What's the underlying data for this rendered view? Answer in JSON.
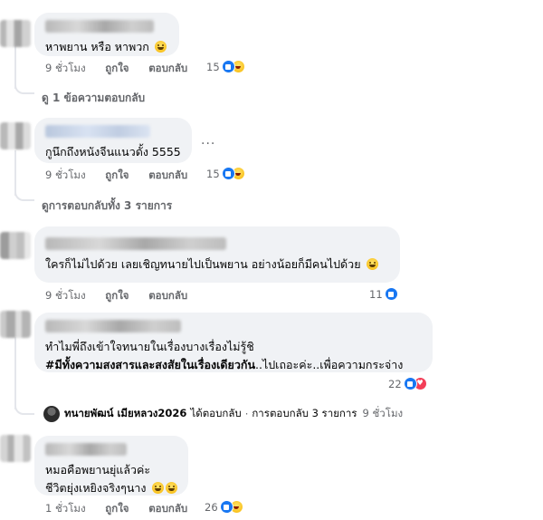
{
  "comments": [
    {
      "text": "หาพยาน หรือ หาพวก",
      "time": "9 ชั่วโมง",
      "like": "ถูกใจ",
      "reply": "ตอบกลับ",
      "count": "15",
      "reactions": [
        "like",
        "haha"
      ]
    },
    {
      "text": "กูนึกถึงหนังจีนแนวดั้ง 5555",
      "time": "9 ชั่วโมง",
      "like": "ถูกใจ",
      "reply": "ตอบกลับ",
      "count": "15",
      "reactions": [
        "like",
        "haha"
      ]
    },
    {
      "text": "ใครก็ไม่ไปด้วย เลยเชิญทนายไปเป็นพยาน อย่างน้อยก็มีคนไปด้วย",
      "time": "9 ชั่วโมง",
      "like": "ถูกใจ",
      "reply": "ตอบกลับ",
      "count": "11",
      "reactions": [
        "like"
      ]
    },
    {
      "text_line1": "ทำไมพี่ถึงเข้าใจทนายในเรื่องบางเรื่องไม่รู้ชิ",
      "hashtag": "#มีทั้งความสงสารและสงสัยในเรื่องเดียวกัน",
      "text_line2_rest": "..ไปเถอะค่ะ..เพื่อความกระจ่าง",
      "time": "9 ชั่วโมง",
      "like": "ถูกใจ",
      "reply": "ตอบกลับ",
      "count": "22",
      "reactions": [
        "like",
        "love"
      ]
    },
    {
      "text_line1": "หมอคือพยานยุ่แล้วค่ะ",
      "text_line2": "ชีวิตยุ่งเหยิงจริงๆนาง",
      "time": "1 ชั่วโมง",
      "like": "ถูกใจ",
      "reply": "ตอบกลับ",
      "count": "26",
      "reactions": [
        "like",
        "haha"
      ]
    }
  ],
  "view_replies_1": "ดู 1 ข้อความตอบกลับ",
  "view_replies_2": "ดูการตอบกลับทั้ง 3 รายการ",
  "reply_summary": {
    "author": "ทนายพัฒน์ เมียหลวง2026",
    "action": "ได้ตอบกลับ",
    "separator": "·",
    "count_text": "การตอบกลับ 3 รายการ",
    "time": "9 ชั่วโมง"
  },
  "more_dots": "...",
  "colors": {
    "bubble": "#f0f2f5",
    "like_blue": "#1877f2",
    "love_red": "#f33e58",
    "meta_gray": "#65676b"
  }
}
